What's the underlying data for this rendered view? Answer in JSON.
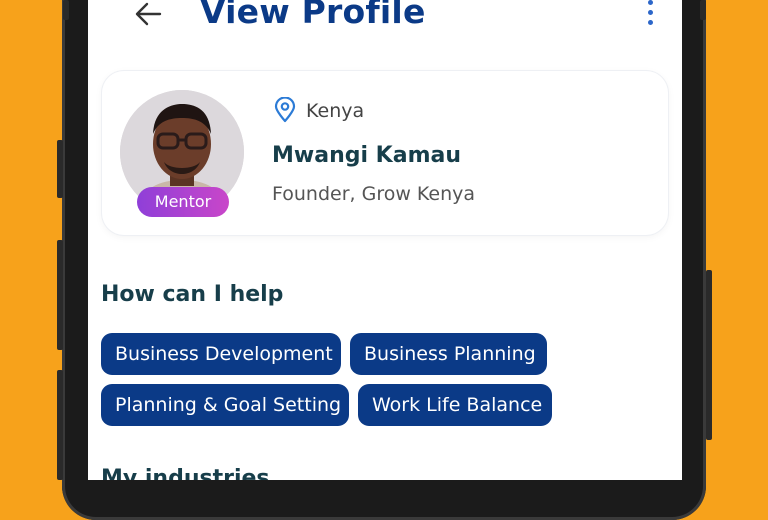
{
  "header": {
    "title": "View Profile",
    "back_icon": "arrow-left-icon",
    "menu_icon": "more-vertical-icon"
  },
  "profile": {
    "location": "Kenya",
    "location_icon": "map-pin-icon",
    "name": "Mwangi Kamau",
    "role": "Founder, Grow Kenya",
    "badge": "Mentor"
  },
  "help": {
    "title": "How can I help",
    "chips": [
      "Business Development",
      "Business Planning",
      "Planning & Goal Setting",
      "Work Life Balance"
    ]
  },
  "industries": {
    "title": "My industries"
  },
  "colors": {
    "primary": "#0b3a87",
    "accent": "#2c66c9",
    "badge_start": "#8f3fd8",
    "badge_end": "#c946c9",
    "background": "#f7a21b"
  }
}
